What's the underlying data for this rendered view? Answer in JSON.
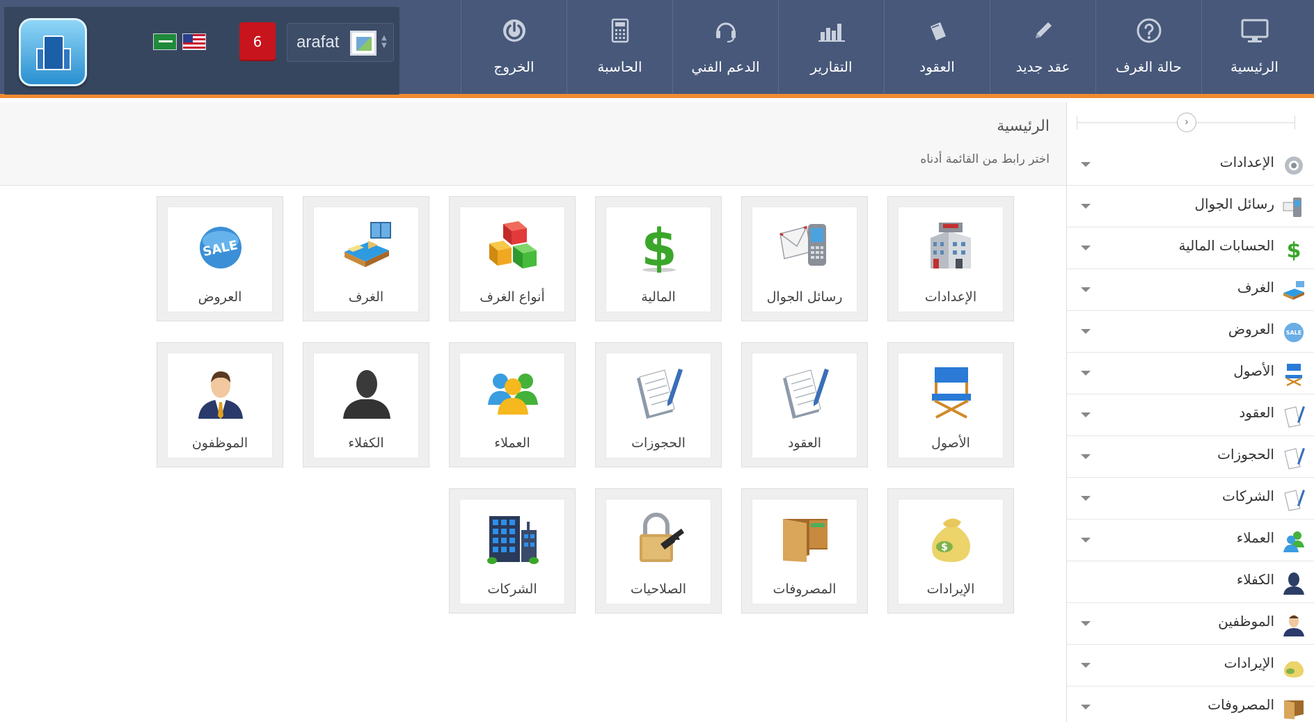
{
  "topbar": {
    "notification_count": "6",
    "username": "arafat",
    "nav": [
      {
        "label": "الخروج",
        "icon": "power-icon"
      },
      {
        "label": "الحاسبة",
        "icon": "calculator-icon"
      },
      {
        "label": "الدعم الفني",
        "icon": "headset-icon"
      },
      {
        "label": "التقارير",
        "icon": "bar-chart-icon"
      },
      {
        "label": "العقود",
        "icon": "contract-icon"
      },
      {
        "label": "عقد جديد",
        "icon": "pencil-icon"
      },
      {
        "label": "حالة الغرف",
        "icon": "question-icon"
      },
      {
        "label": "الرئيسية",
        "icon": "monitor-icon"
      }
    ]
  },
  "breadcrumb": {
    "title": "الرئيسية",
    "subtitle": "اختر رابط من القائمة أدناه"
  },
  "tiles": [
    {
      "label": "العروض",
      "icon": "sale-badge-icon"
    },
    {
      "label": "الغرف",
      "icon": "bed-icon"
    },
    {
      "label": "أنواع الغرف",
      "icon": "boxes-icon"
    },
    {
      "label": "المالية",
      "icon": "dollar-icon"
    },
    {
      "label": "رسائل الجوال",
      "icon": "mobile-mail-icon"
    },
    {
      "label": "الإعدادات",
      "icon": "building-settings-icon"
    },
    {
      "label": "الموظفون",
      "icon": "businessman-icon"
    },
    {
      "label": "الكفلاء",
      "icon": "person-silhouette-icon"
    },
    {
      "label": "العملاء",
      "icon": "users-group-icon"
    },
    {
      "label": "الحجوزات",
      "icon": "notepad-pen-icon"
    },
    {
      "label": "العقود",
      "icon": "notepad-pen-icon"
    },
    {
      "label": "الأصول",
      "icon": "director-chair-icon"
    },
    {
      "label": "الشركات",
      "icon": "office-building-icon"
    },
    {
      "label": "الصلاحيات",
      "icon": "padlock-key-icon"
    },
    {
      "label": "المصروفات",
      "icon": "wallet-icon"
    },
    {
      "label": "الإيرادات",
      "icon": "money-bag-icon"
    }
  ],
  "sidebar": {
    "items": [
      {
        "label": "الإعدادات",
        "icon": "gear-icon",
        "has_caret": true
      },
      {
        "label": "رسائل الجوال",
        "icon": "mobile-icon",
        "has_caret": true
      },
      {
        "label": "الحسابات المالية",
        "icon": "dollar-icon",
        "has_caret": true
      },
      {
        "label": "الغرف",
        "icon": "bed-icon",
        "has_caret": true
      },
      {
        "label": "العروض",
        "icon": "sale-badge-icon",
        "has_caret": true
      },
      {
        "label": "الأصول",
        "icon": "director-chair-icon",
        "has_caret": true
      },
      {
        "label": "العقود",
        "icon": "notepad-icon",
        "has_caret": true
      },
      {
        "label": "الحجوزات",
        "icon": "notepad-icon",
        "has_caret": true
      },
      {
        "label": "الشركات",
        "icon": "notepad-icon",
        "has_caret": true
      },
      {
        "label": "العملاء",
        "icon": "users-group-icon",
        "has_caret": true
      },
      {
        "label": "الكفلاء",
        "icon": "person-silhouette-icon",
        "has_caret": false
      },
      {
        "label": "الموظفين",
        "icon": "businessman-icon",
        "has_caret": true
      },
      {
        "label": "الإيرادات",
        "icon": "money-bag-icon",
        "has_caret": true
      },
      {
        "label": "المصروفات",
        "icon": "wallet-icon",
        "has_caret": true
      }
    ]
  },
  "colors": {
    "topbar": "#47587a",
    "brand_box": "#37465f",
    "accent_border": "#f08a30",
    "badge": "#c8141c"
  }
}
